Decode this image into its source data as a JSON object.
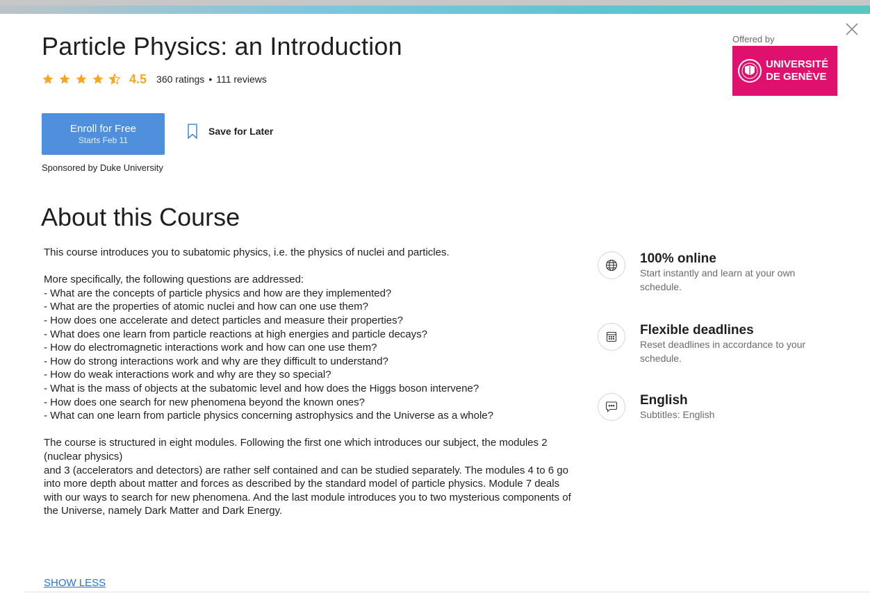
{
  "course": {
    "title": "Particle Physics: an Introduction",
    "rating": "4.5",
    "ratings_count": "360 ratings",
    "separator": "•",
    "reviews_count": "111 reviews"
  },
  "actions": {
    "enroll_label": "Enroll for Free",
    "enroll_sublabel": "Starts Feb 11",
    "save_label": "Save for Later",
    "sponsor": "Sponsored by Duke University"
  },
  "partner": {
    "offered_by": "Offered by",
    "logo_line1": "UNIVERSITÉ",
    "logo_line2": "DE GENÈVE"
  },
  "about": {
    "heading": "About this Course",
    "intro": "This course introduces you to subatomic physics, i.e. the physics of nuclei and particles.",
    "questions_intro": "More specifically, the following questions are addressed:",
    "questions": [
      "- What are the concepts of particle physics and how are they implemented?",
      "- What are the properties of atomic nuclei and how can one use them?",
      "- How does one accelerate and detect particles and measure their properties?",
      "- What does one learn from particle reactions at high energies and particle decays?",
      "- How do electromagnetic interactions work and how can one use them?",
      "- How do strong interactions work and why are they difficult to understand?",
      "- How do weak interactions work and why are they so special?",
      "- What is the mass of objects at the subatomic level and how does the Higgs boson intervene?",
      "- How does one search for new phenomena beyond the known ones?",
      "- What can one learn from particle physics concerning astrophysics and the Universe as a whole?"
    ],
    "structure_line1": "The course is structured in eight modules. Following the first one which introduces our subject, the modules 2 (nuclear physics)",
    "structure_line2": "and 3 (accelerators and detectors) are rather self contained and can be studied separately. The modules 4 to 6 go into more depth about matter and forces as described by the standard model of particle physics. Module 7 deals with our ways to search for new phenomena. And the last module introduces you to two mysterious components of the Universe, namely Dark Matter and Dark Energy.",
    "show_less": "SHOW LESS"
  },
  "features": [
    {
      "icon": "globe-icon",
      "title": "100% online",
      "subtitle": "Start instantly and learn at your own schedule."
    },
    {
      "icon": "calendar-icon",
      "title": "Flexible deadlines",
      "subtitle": "Reset deadlines in accordance to your schedule."
    },
    {
      "icon": "chat-bubble-icon",
      "title": "English",
      "subtitle": "Subtitles: English"
    }
  ],
  "colors": {
    "star": "#f5a623",
    "enroll_button": "#4f8fdc",
    "logo_background": "#e0106e",
    "link": "#2a73cc"
  }
}
